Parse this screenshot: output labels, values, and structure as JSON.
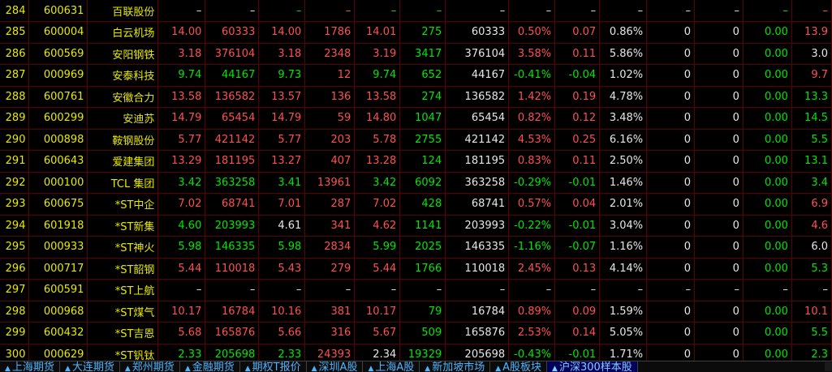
{
  "rows": [
    {
      "n": "284",
      "code": "600631",
      "name": "百联股份",
      "c": [
        "–",
        "–",
        "–",
        "–",
        "–",
        "–",
        "–",
        "–",
        "–",
        "–",
        "–",
        "–",
        "–",
        "–"
      ],
      "k": [
        "w",
        "w",
        "g",
        "r",
        "g",
        "g",
        "w",
        "w",
        "w",
        "w",
        "w",
        "w",
        "g",
        "r"
      ]
    },
    {
      "n": "285",
      "code": "600004",
      "name": "白云机场",
      "c": [
        "14.00",
        "60333",
        "14.00",
        "1786",
        "14.01",
        "275",
        "60333",
        "0.50%",
        "0.07",
        "0.86%",
        "0",
        "0",
        "0.00",
        "13.9"
      ],
      "k": [
        "r",
        "r",
        "r",
        "r",
        "r",
        "g",
        "w",
        "r",
        "r",
        "w",
        "w",
        "w",
        "g",
        "r"
      ]
    },
    {
      "n": "286",
      "code": "600569",
      "name": "安阳钢铁",
      "c": [
        "3.18",
        "376104",
        "3.18",
        "2348",
        "3.19",
        "3417",
        "376104",
        "3.58%",
        "0.11",
        "5.86%",
        "0",
        "0",
        "0.00",
        "3.0"
      ],
      "k": [
        "r",
        "r",
        "r",
        "r",
        "r",
        "g",
        "w",
        "r",
        "r",
        "w",
        "w",
        "w",
        "g",
        "w"
      ]
    },
    {
      "n": "287",
      "code": "000969",
      "name": "安泰科技",
      "c": [
        "9.74",
        "44167",
        "9.73",
        "12",
        "9.74",
        "652",
        "44167",
        "-0.41%",
        "-0.04",
        "1.02%",
        "0",
        "0",
        "0.00",
        "9.7"
      ],
      "k": [
        "g",
        "g",
        "g",
        "r",
        "g",
        "g",
        "w",
        "g",
        "g",
        "w",
        "w",
        "w",
        "g",
        "r"
      ]
    },
    {
      "n": "288",
      "code": "600761",
      "name": "安徽合力",
      "c": [
        "13.58",
        "136582",
        "13.57",
        "136",
        "13.58",
        "274",
        "136582",
        "1.42%",
        "0.19",
        "4.78%",
        "0",
        "0",
        "0.00",
        "13.3"
      ],
      "k": [
        "r",
        "r",
        "r",
        "r",
        "r",
        "g",
        "w",
        "r",
        "r",
        "w",
        "w",
        "w",
        "g",
        "g"
      ]
    },
    {
      "n": "289",
      "code": "600299",
      "name": "安迪苏",
      "c": [
        "14.79",
        "65454",
        "14.79",
        "59",
        "14.80",
        "1047",
        "65454",
        "0.82%",
        "0.12",
        "3.48%",
        "0",
        "0",
        "0.00",
        "14.5"
      ],
      "k": [
        "r",
        "r",
        "r",
        "r",
        "r",
        "g",
        "w",
        "r",
        "r",
        "w",
        "w",
        "w",
        "g",
        "g"
      ]
    },
    {
      "n": "290",
      "code": "000898",
      "name": "鞍钢股份",
      "c": [
        "5.77",
        "421142",
        "5.77",
        "203",
        "5.78",
        "2755",
        "421142",
        "4.53%",
        "0.25",
        "6.16%",
        "0",
        "0",
        "0.00",
        "5.5"
      ],
      "k": [
        "r",
        "r",
        "r",
        "r",
        "r",
        "g",
        "w",
        "r",
        "r",
        "w",
        "w",
        "w",
        "g",
        "g"
      ]
    },
    {
      "n": "291",
      "code": "600643",
      "name": "爱建集团",
      "c": [
        "13.29",
        "181195",
        "13.27",
        "407",
        "13.28",
        "124",
        "181195",
        "0.83%",
        "0.11",
        "2.50%",
        "0",
        "0",
        "0.00",
        "13.1"
      ],
      "k": [
        "r",
        "r",
        "r",
        "r",
        "r",
        "g",
        "w",
        "r",
        "r",
        "w",
        "w",
        "w",
        "g",
        "g"
      ]
    },
    {
      "n": "292",
      "code": "000100",
      "name": "TCL 集团",
      "c": [
        "3.42",
        "363258",
        "3.41",
        "13961",
        "3.42",
        "6092",
        "363258",
        "-0.29%",
        "-0.01",
        "1.46%",
        "0",
        "0",
        "0.00",
        "3.4"
      ],
      "k": [
        "g",
        "g",
        "g",
        "r",
        "g",
        "g",
        "w",
        "g",
        "g",
        "w",
        "w",
        "w",
        "g",
        "g"
      ]
    },
    {
      "n": "293",
      "code": "600675",
      "name": "*ST中企",
      "c": [
        "7.02",
        "68741",
        "7.01",
        "287",
        "7.02",
        "428",
        "68741",
        "0.57%",
        "0.04",
        "2.01%",
        "0",
        "0",
        "0.00",
        "6.9"
      ],
      "k": [
        "r",
        "r",
        "r",
        "r",
        "r",
        "g",
        "w",
        "r",
        "r",
        "w",
        "w",
        "w",
        "g",
        "r"
      ]
    },
    {
      "n": "294",
      "code": "601918",
      "name": "*ST新集",
      "c": [
        "4.60",
        "203993",
        "4.61",
        "341",
        "4.62",
        "1141",
        "203993",
        "-0.22%",
        "-0.01",
        "3.04%",
        "0",
        "0",
        "0.00",
        "4.6"
      ],
      "k": [
        "g",
        "g",
        "w",
        "r",
        "r",
        "g",
        "w",
        "g",
        "g",
        "w",
        "w",
        "w",
        "g",
        "r"
      ]
    },
    {
      "n": "295",
      "code": "000933",
      "name": "*ST神火",
      "c": [
        "5.98",
        "146335",
        "5.98",
        "2834",
        "5.99",
        "2025",
        "146335",
        "-1.16%",
        "-0.07",
        "1.16%",
        "0",
        "0",
        "0.00",
        "6.0"
      ],
      "k": [
        "g",
        "g",
        "g",
        "r",
        "g",
        "g",
        "w",
        "g",
        "g",
        "w",
        "w",
        "w",
        "g",
        "w"
      ]
    },
    {
      "n": "296",
      "code": "000717",
      "name": "*ST韶钢",
      "c": [
        "5.44",
        "110018",
        "5.43",
        "279",
        "5.44",
        "1766",
        "110018",
        "2.45%",
        "0.13",
        "4.14%",
        "0",
        "0",
        "0.00",
        "5.3"
      ],
      "k": [
        "r",
        "r",
        "r",
        "r",
        "r",
        "g",
        "w",
        "r",
        "r",
        "w",
        "w",
        "w",
        "g",
        "g"
      ]
    },
    {
      "n": "297",
      "code": "600591",
      "name": "*ST上航",
      "c": [
        "–",
        "–",
        "–",
        "–",
        "–",
        "–",
        "–",
        "–",
        "–",
        "–",
        "–",
        "–",
        "–",
        "–"
      ],
      "k": [
        "w",
        "w",
        "w",
        "w",
        "w",
        "w",
        "w",
        "w",
        "w",
        "w",
        "w",
        "w",
        "w",
        "w"
      ]
    },
    {
      "n": "298",
      "code": "000968",
      "name": "*ST煤气",
      "c": [
        "10.17",
        "16784",
        "10.16",
        "381",
        "10.17",
        "79",
        "16784",
        "0.89%",
        "0.09",
        "1.59%",
        "0",
        "0",
        "0.00",
        "10.1"
      ],
      "k": [
        "r",
        "r",
        "r",
        "r",
        "r",
        "g",
        "w",
        "r",
        "r",
        "w",
        "w",
        "w",
        "g",
        "r"
      ]
    },
    {
      "n": "299",
      "code": "600432",
      "name": "*ST吉恩",
      "c": [
        "5.68",
        "165876",
        "5.66",
        "316",
        "5.67",
        "509",
        "165876",
        "2.53%",
        "0.14",
        "5.05%",
        "0",
        "0",
        "0.00",
        "5.5"
      ],
      "k": [
        "r",
        "r",
        "r",
        "r",
        "r",
        "g",
        "w",
        "r",
        "r",
        "w",
        "w",
        "w",
        "g",
        "g"
      ]
    },
    {
      "n": "300",
      "code": "000629",
      "name": "*ST钒钛",
      "c": [
        "2.33",
        "205698",
        "2.33",
        "24393",
        "2.34",
        "19329",
        "205698",
        "-0.43%",
        "-0.01",
        "1.71%",
        "0",
        "0",
        "0.00",
        "2.3"
      ],
      "k": [
        "g",
        "g",
        "g",
        "r",
        "w",
        "g",
        "w",
        "g",
        "g",
        "w",
        "w",
        "w",
        "g",
        "g"
      ]
    }
  ],
  "tabs": [
    {
      "label": "上海期货"
    },
    {
      "label": "大连期货"
    },
    {
      "label": "郑州期货"
    },
    {
      "label": "金融期货"
    },
    {
      "label": "期权T报价"
    },
    {
      "label": "深圳A股"
    },
    {
      "label": "上海A股"
    },
    {
      "label": "新加坡市场"
    },
    {
      "label": "A股板块"
    },
    {
      "label": "沪深300样本股",
      "active": true
    }
  ],
  "colors": {
    "up": "#ff5050",
    "down": "#00e600",
    "neutral": "#e6e6e6",
    "label": "#e8e800",
    "grid": "#5a0000",
    "tab": "#4fb4ff"
  }
}
